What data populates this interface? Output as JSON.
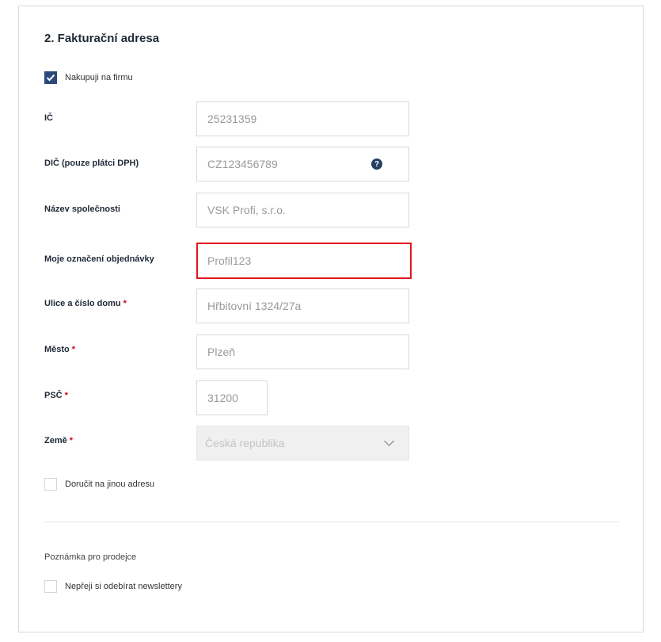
{
  "section": {
    "title": "2. Fakturační adresa"
  },
  "company_checkbox": {
    "label": "Nakupuji na firmu",
    "checked": true
  },
  "fields": {
    "ic": {
      "label": "IČ",
      "value": "25231359",
      "required": false
    },
    "dic": {
      "label": "DIČ (pouze plátci DPH)",
      "value": "CZ123456789",
      "help_icon": "question-mark-icon",
      "help_glyph": "?"
    },
    "company_name": {
      "label": "Název společnosti",
      "value": "VSK Profi, s.r.o."
    },
    "order_ref": {
      "label": "Moje označení objednávky",
      "value": "Profil123",
      "highlight_color": "#e3141b"
    },
    "street": {
      "label": "Ulice a číslo domu",
      "value": "Hřbitovní 1324/27a",
      "required_mark": "*"
    },
    "city": {
      "label": "Město",
      "value": "Plzeň",
      "required_mark": "*"
    },
    "zip": {
      "label": "PSČ",
      "value": "31200",
      "required_mark": "*"
    },
    "country": {
      "label": "Země",
      "value": "Česká republika",
      "required_mark": "*",
      "disabled": true,
      "icon": "chevron-down-icon"
    }
  },
  "other_address_checkbox": {
    "label": "Doručit na jinou adresu",
    "checked": false
  },
  "seller_note": {
    "label": "Poznámka pro prodejce"
  },
  "newsletter_checkbox": {
    "label": "Nepřeji si odebírat newslettery",
    "checked": false
  },
  "colors": {
    "accent": "#2b4a7a",
    "required": "#d0021b",
    "highlight": "#e3141b"
  }
}
